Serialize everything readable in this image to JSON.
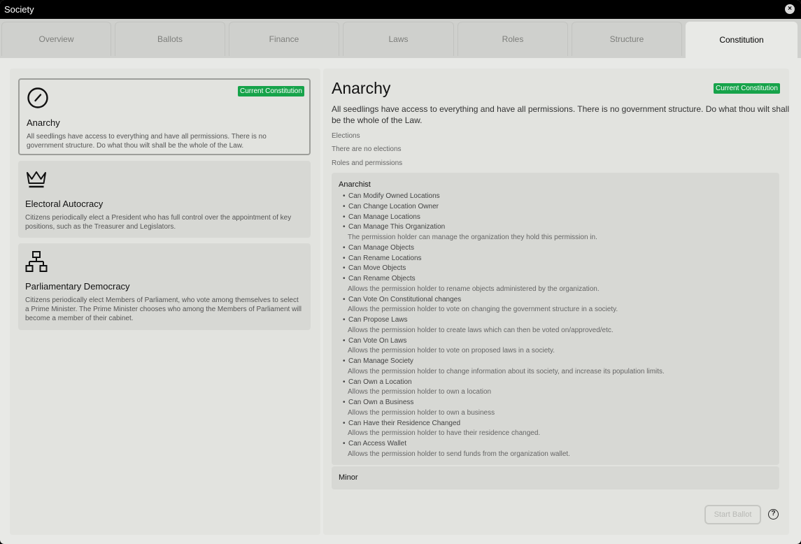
{
  "window": {
    "title": "Society"
  },
  "tabs": [
    "Overview",
    "Ballots",
    "Finance",
    "Laws",
    "Roles",
    "Structure",
    "Constitution"
  ],
  "active_tab": "Constitution",
  "constitutions": [
    {
      "name": "Anarchy",
      "icon": "slashed-circle-icon",
      "badge": "Current Constitution",
      "description": "All seedlings have access to everything and have all permissions. There is no government structure. Do what thou wilt shall be the whole of the Law."
    },
    {
      "name": "Electoral Autocracy",
      "icon": "crown-icon",
      "description": "Citizens periodically elect a President who has full control over the appointment of key positions, such as the Treasurer and Legislators."
    },
    {
      "name": "Parliamentary Democracy",
      "icon": "org-chart-icon",
      "description": "Citizens periodically elect Members of Parliament, who vote among themselves to select a Prime Minister. The Prime Minister chooses who among the Members of Parliament will become a member of their cabinet."
    }
  ],
  "detail": {
    "title": "Anarchy",
    "badge": "Current Constitution",
    "description": "All seedlings have access to everything and have all permissions. There is no government structure. Do what thou wilt shall be the whole of the Law.",
    "elections_label": "Elections",
    "elections_text": "There are no elections",
    "roles_label": "Roles and permissions",
    "roles": [
      {
        "name": "Anarchist",
        "permissions": [
          {
            "name": "Can Modify Owned Locations"
          },
          {
            "name": "Can Change Location Owner"
          },
          {
            "name": "Can Manage Locations"
          },
          {
            "name": "Can Manage This Organization",
            "desc": "The permission holder can manage the organization they hold this permission in."
          },
          {
            "name": "Can Manage Objects"
          },
          {
            "name": "Can Rename Locations"
          },
          {
            "name": "Can Move Objects"
          },
          {
            "name": "Can Rename Objects",
            "desc": "Allows the permission holder to rename objects administered by the organization."
          },
          {
            "name": "Can Vote On Constitutional changes",
            "desc": "Allows the permission holder to vote on changing the government structure in a society."
          },
          {
            "name": "Can Propose Laws",
            "desc": "Allows the permission holder to create laws which can then be voted on/approved/etc."
          },
          {
            "name": "Can Vote On Laws",
            "desc": "Allows the permission holder to vote on proposed laws in a society."
          },
          {
            "name": "Can Manage Society",
            "desc": "Allows the permission holder to change information about its society, and increase its population limits."
          },
          {
            "name": "Can Own a Location",
            "desc": "Allows the permission holder to own a location"
          },
          {
            "name": "Can Own a Business",
            "desc": "Allows the permission holder to own a business"
          },
          {
            "name": "Can Have their Residence Changed",
            "desc": "Allows the permission holder to have their residence changed."
          },
          {
            "name": "Can Access Wallet",
            "desc": "Allows the permission holder to send funds from the organization wallet."
          }
        ]
      },
      {
        "name": "Minor",
        "permissions": []
      }
    ]
  },
  "actions": {
    "start_ballot": "Start Ballot",
    "help": "?"
  },
  "colors": {
    "badge": "#16a34a",
    "titlebar": "#000000",
    "panel": "#e2e3df",
    "card": "#d7d8d4"
  }
}
